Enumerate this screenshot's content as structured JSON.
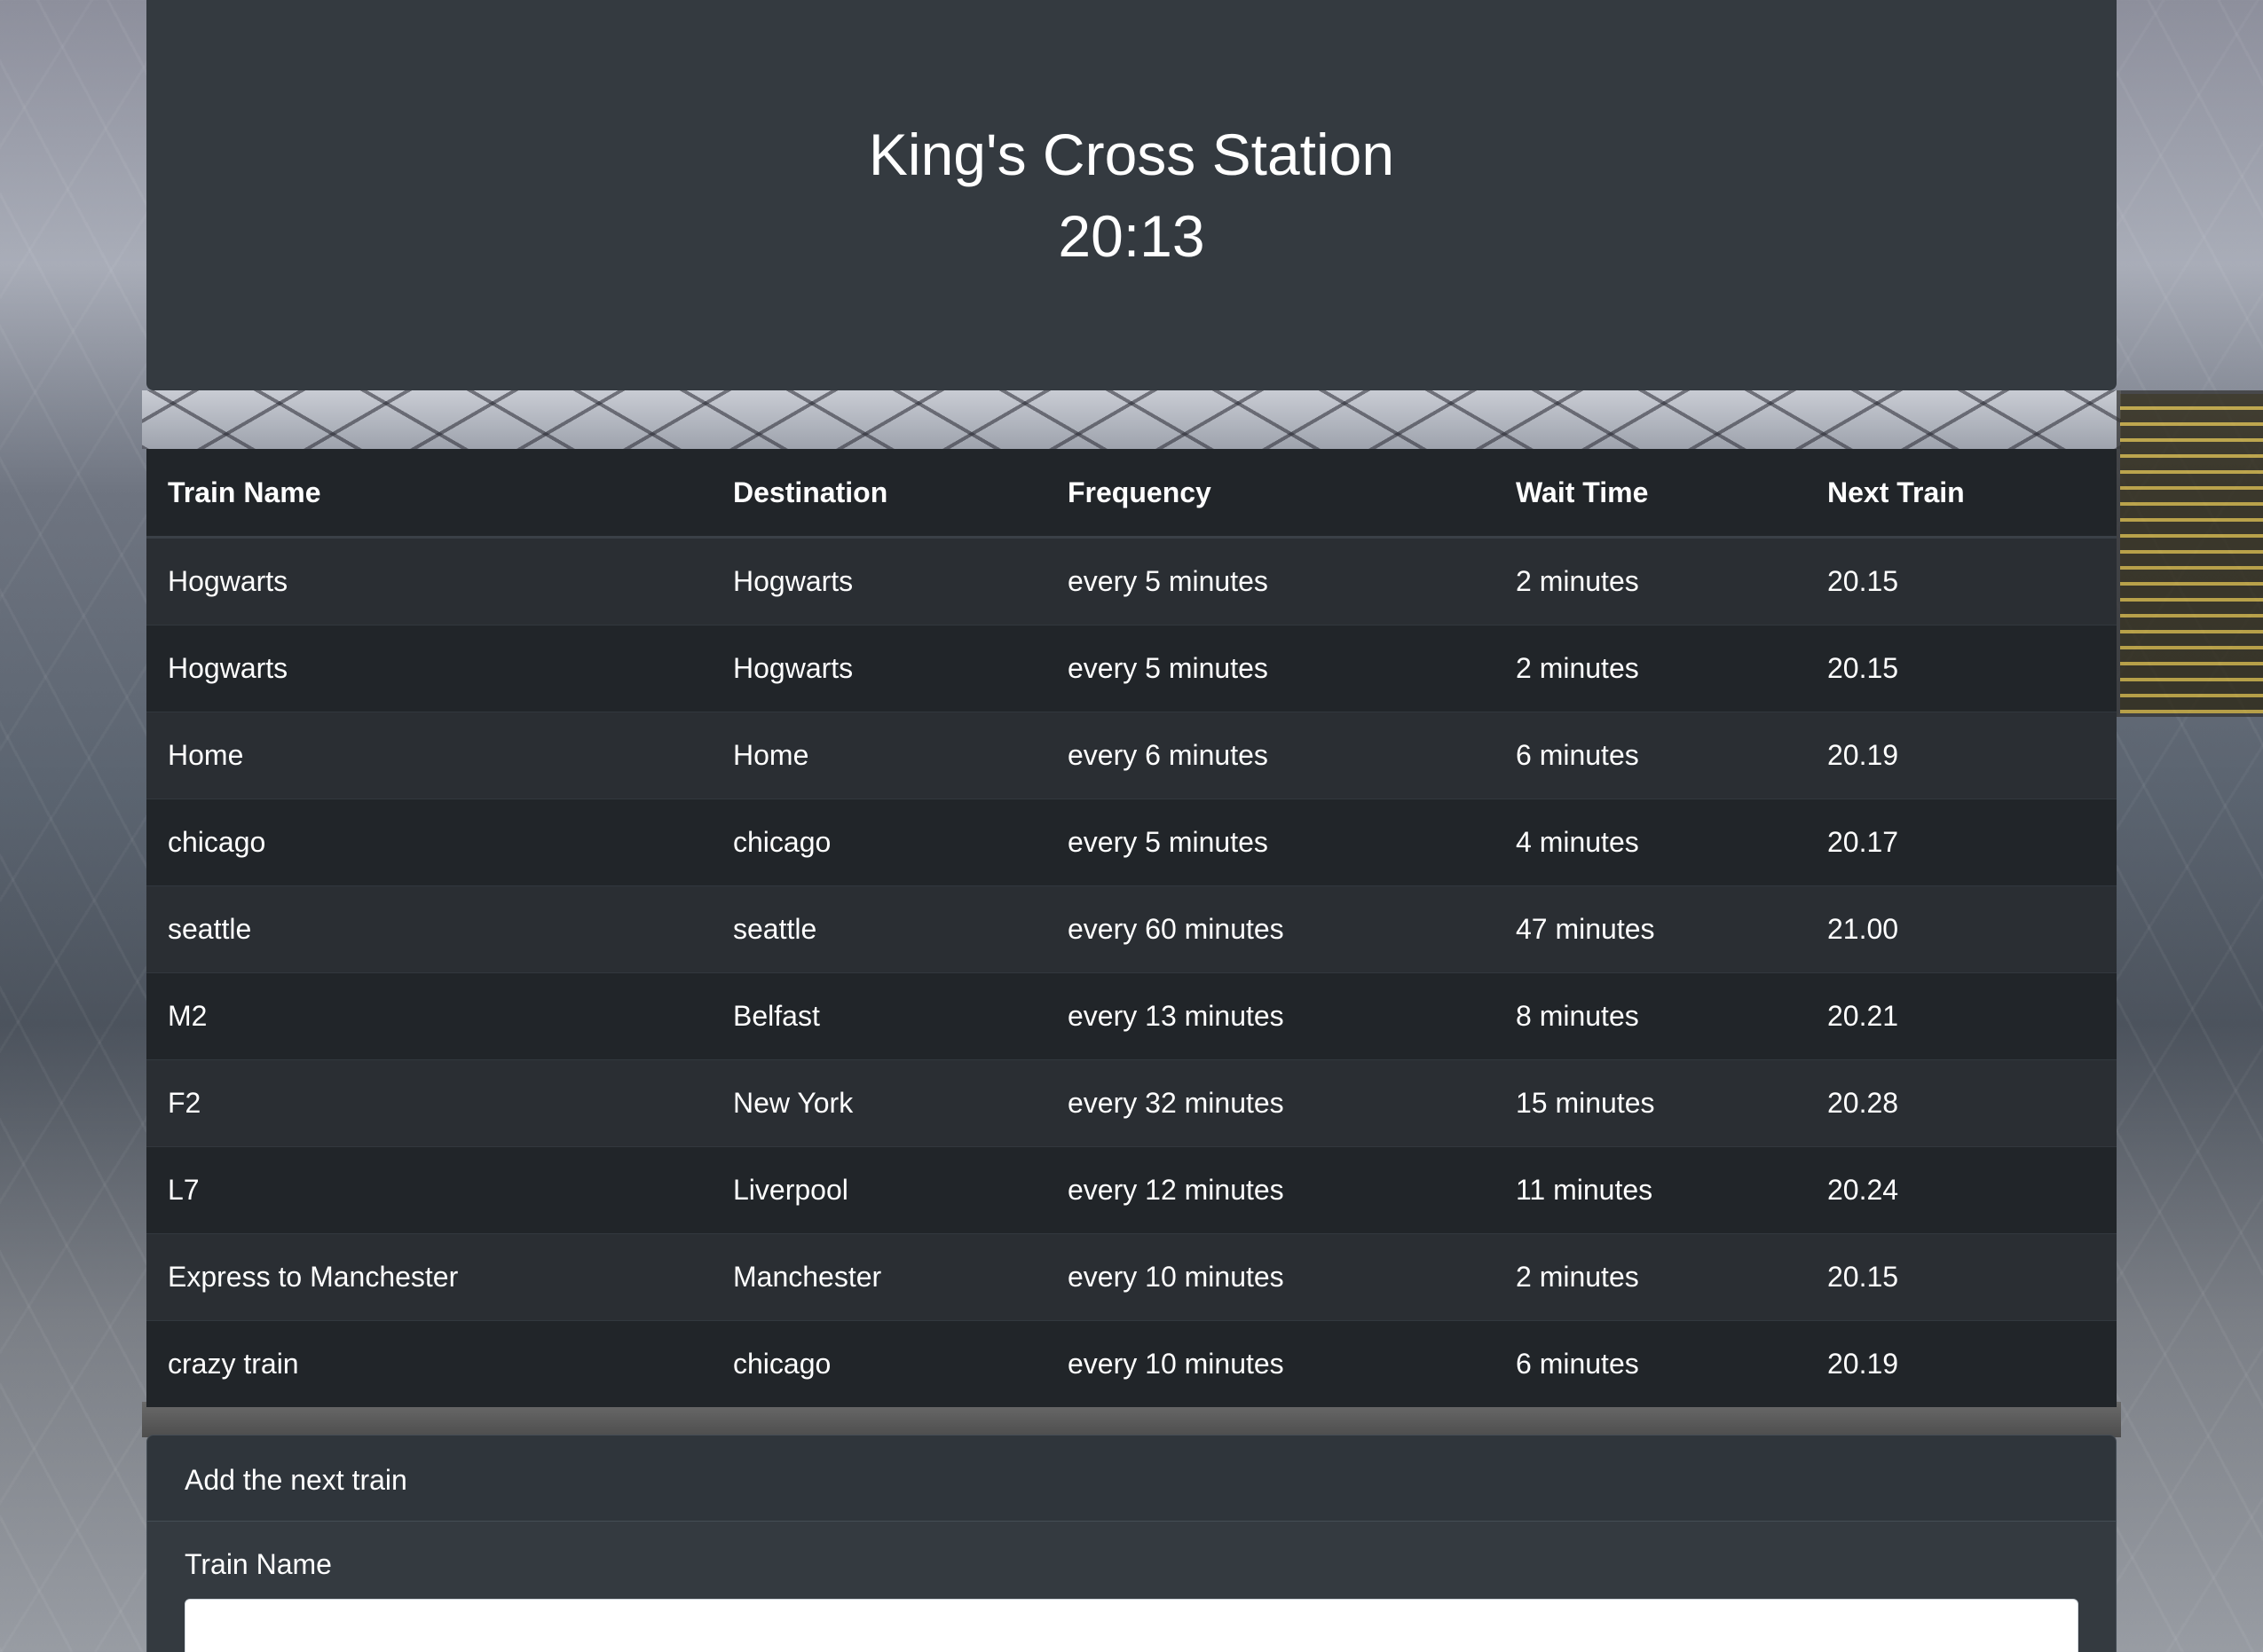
{
  "header": {
    "station_name": "King's Cross Station",
    "current_time": "20:13"
  },
  "schedule": {
    "columns": [
      "Train Name",
      "Destination",
      "Frequency",
      "Wait Time",
      "Next Train"
    ],
    "rows": [
      [
        "Hogwarts",
        "Hogwarts",
        "every 5 minutes",
        "2 minutes",
        "20.15"
      ],
      [
        "Hogwarts",
        "Hogwarts",
        "every 5 minutes",
        "2 minutes",
        "20.15"
      ],
      [
        "Home",
        "Home",
        "every 6 minutes",
        "6 minutes",
        "20.19"
      ],
      [
        "chicago",
        "chicago",
        "every 5 minutes",
        "4 minutes",
        "20.17"
      ],
      [
        "seattle",
        "seattle",
        "every 60 minutes",
        "47 minutes",
        "21.00"
      ],
      [
        "M2",
        "Belfast",
        "every 13 minutes",
        "8 minutes",
        "20.21"
      ],
      [
        "F2",
        "New York",
        "every 32 minutes",
        "15 minutes",
        "20.28"
      ],
      [
        "L7",
        "Liverpool",
        "every 12 minutes",
        "11 minutes",
        "20.24"
      ],
      [
        "Express to Manchester",
        "Manchester",
        "every 10 minutes",
        "2 minutes",
        "20.15"
      ],
      [
        "crazy train",
        "chicago",
        "every 10 minutes",
        "6 minutes",
        "20.19"
      ]
    ]
  },
  "add_train": {
    "title": "Add the next train",
    "train_name_label": "Train Name",
    "train_name_value": ""
  }
}
